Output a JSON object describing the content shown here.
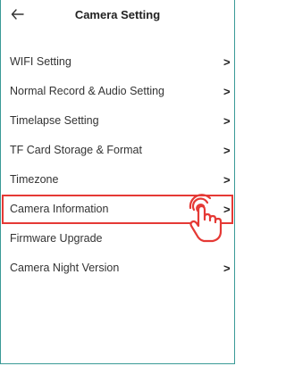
{
  "header": {
    "title": "Camera Setting",
    "back_icon": "arrow-left-icon"
  },
  "menu": {
    "items": [
      {
        "label": "WIFI Setting",
        "chevron": ">"
      },
      {
        "label": "Normal Record & Audio Setting",
        "chevron": ">"
      },
      {
        "label": "Timelapse Setting",
        "chevron": ">"
      },
      {
        "label": "TF Card Storage & Format",
        "chevron": ">"
      },
      {
        "label": "Timezone",
        "chevron": ">"
      },
      {
        "label": "Camera Information",
        "chevron": ">"
      },
      {
        "label": "Firmware Upgrade",
        "chevron": ""
      },
      {
        "label": "Camera Night Version",
        "chevron": ">"
      }
    ],
    "highlighted_item": "Camera Information"
  },
  "colors": {
    "highlight": "#e53935",
    "frame": "#3a9a97"
  },
  "pointer_icon": "tap-hand-icon"
}
